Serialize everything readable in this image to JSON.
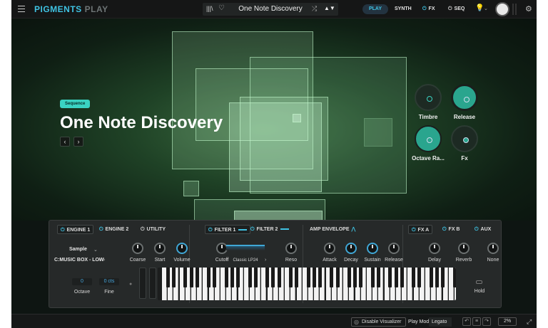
{
  "topbar": {
    "logo_main": "PIGMENTS",
    "logo_sub": "PLAY",
    "preset_name": "One Note Discovery",
    "nav": {
      "play": "PLAY",
      "synth": "SYNTH",
      "fx": "FX",
      "seq": "SEQ"
    },
    "icons": [
      "menu-icon",
      "library-icon",
      "heart-icon",
      "shuffle-icon",
      "arrows-icon",
      "bulb-icon",
      "gear-icon"
    ]
  },
  "hero": {
    "badge": "Sequence",
    "title": "One Note Discovery",
    "prev": "‹",
    "next": "›",
    "macros": {
      "timbre": "Timbre",
      "release": "Release",
      "octave": "Octave Ra...",
      "fx": "Fx"
    }
  },
  "panel": {
    "tabs": {
      "engine1": "ENGINE 1",
      "engine2": "ENGINE 2",
      "utility": "UTILITY",
      "filter1": "FILTER 1",
      "filter2": "FILTER 2",
      "amp": "AMP ENVELOPE",
      "fxa": "FX A",
      "fxb": "FX B",
      "aux": "AUX"
    },
    "sample_title": "Sample",
    "sample_name": "C:MUSIC BOX - LOW",
    "knobs": {
      "coarse": "Coarse",
      "start": "Start",
      "volume": "Volume",
      "cutoff": "Cutoff",
      "reso": "Reso",
      "attack": "Attack",
      "decay": "Decay",
      "sustain": "Sustain",
      "release": "Release",
      "delay": "Delay",
      "reverb": "Reverb",
      "none": "None"
    },
    "filter_type": "Classic LP24",
    "octave_value": "0",
    "octave_label": "Octave",
    "fine_value": "0 cts",
    "fine_label": "Fine",
    "hold_label": "Hold"
  },
  "status": {
    "disable_visualizer": "Disable Visualizer",
    "play_mode_label": "Play Mode",
    "play_mode_value": "Legato",
    "cpu": "2%"
  },
  "colors": {
    "accent": "#3fc3e3",
    "teal": "#3ad3c2",
    "background": "#0e1512"
  }
}
